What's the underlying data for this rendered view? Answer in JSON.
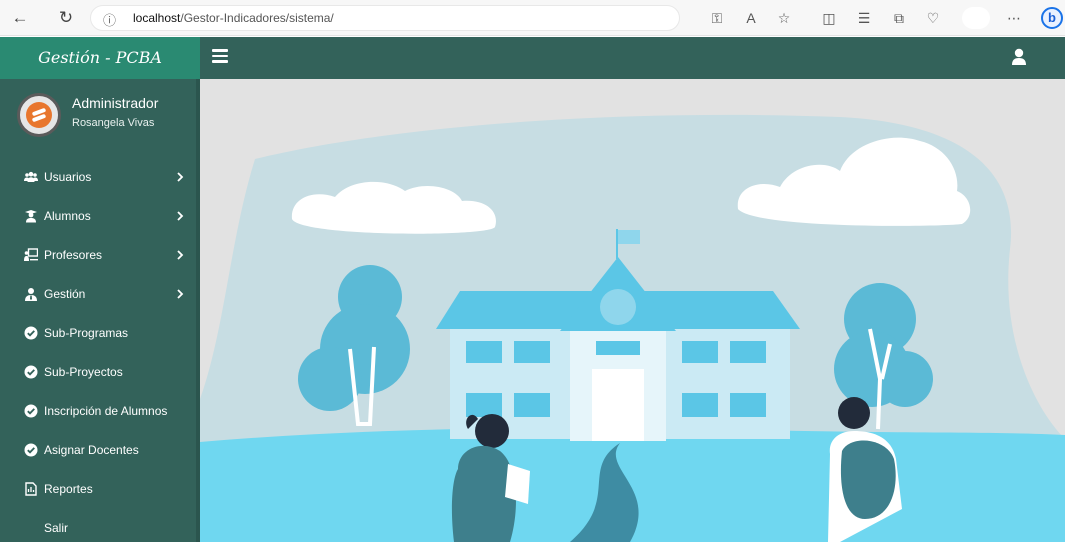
{
  "browser": {
    "url_host": "localhost",
    "url_path": "/Gestor-Indicadores/sistema/"
  },
  "app": {
    "brand": "Gestión - PCBA"
  },
  "user": {
    "role": "Administrador",
    "name": "Rosangela Vivas"
  },
  "sidebar": {
    "items": [
      {
        "label": "Usuarios",
        "icon": "users-icon"
      },
      {
        "label": "Alumnos",
        "icon": "student-icon"
      },
      {
        "label": "Profesores",
        "icon": "teacher-icon"
      },
      {
        "label": "Gestión",
        "icon": "user-tie-icon"
      },
      {
        "label": "Sub-Programas",
        "icon": "check-circle-icon"
      },
      {
        "label": "Sub-Proyectos",
        "icon": "check-circle-icon"
      },
      {
        "label": "Inscripción de Alumnos",
        "icon": "check-circle-icon"
      },
      {
        "label": "Asignar Docentes",
        "icon": "check-circle-icon"
      },
      {
        "label": "Reportes",
        "icon": "report-icon"
      },
      {
        "label": "Salir"
      }
    ]
  },
  "colors": {
    "sidebar": "#33625a",
    "brand": "#2a8a72",
    "illustration_sky": "#c7dde3",
    "illustration_ground": "#6fd7f0",
    "illustration_tree": "#5bbad6"
  }
}
